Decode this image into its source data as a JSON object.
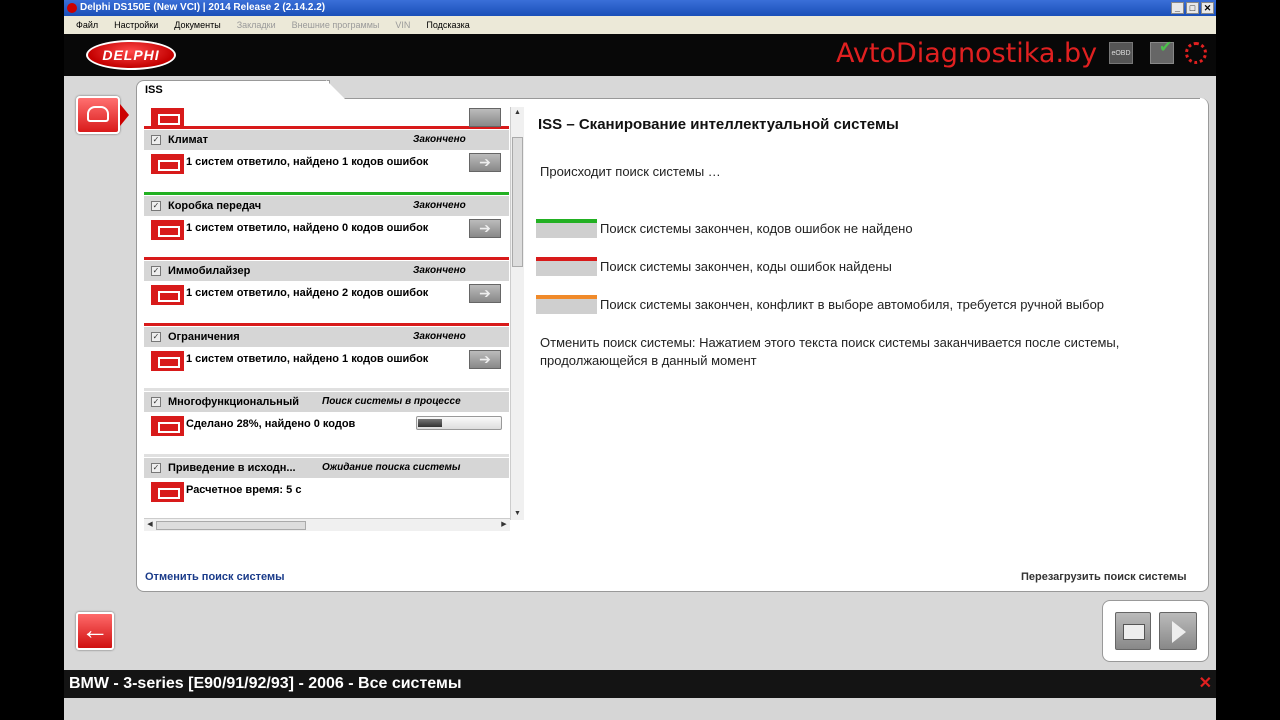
{
  "window": {
    "title": "Delphi DS150E (New VCI) | 2014 Release 2 (2.14.2.2)",
    "buttons": [
      "_",
      "□",
      "✕"
    ]
  },
  "menu": [
    {
      "label": "Файл",
      "enabled": true
    },
    {
      "label": "Настройки",
      "enabled": true
    },
    {
      "label": "Документы",
      "enabled": true
    },
    {
      "label": "Закладки",
      "enabled": false
    },
    {
      "label": "Внешние программы",
      "enabled": false
    },
    {
      "label": "VIN",
      "enabled": false
    },
    {
      "label": "Подсказка",
      "enabled": true
    }
  ],
  "header": {
    "logo_text": "DELPHI",
    "watermark": "AvtoDiagnostika.by",
    "eobd_label": "eOBD"
  },
  "tab_label": "ISS",
  "systems": [
    {
      "name": "Климат",
      "status": "Закончено",
      "desc": "1 систем ответило, найдено 1 кодов ошибок",
      "bar_color": "#d81a1a",
      "icon": "climate-icon",
      "kind": "done"
    },
    {
      "name": "Коробка передач",
      "status": "Закончено",
      "desc": "1 систем ответило, найдено 0 кодов ошибок",
      "bar_color": "#22b022",
      "icon": "gearbox-icon",
      "kind": "done"
    },
    {
      "name": "Иммобилайзер",
      "status": "Закончено",
      "desc": "1 систем ответило, найдено 2 кодов ошибок",
      "bar_color": "#d81a1a",
      "icon": "key-icon",
      "kind": "done"
    },
    {
      "name": "Ограничения",
      "status": "Закончено",
      "desc": "1 систем ответило, найдено 1 кодов ошибок",
      "bar_color": "#d81a1a",
      "icon": "airbag-icon",
      "kind": "done"
    },
    {
      "name": "Многофункциональный",
      "status": "Поиск системы в процессе",
      "desc": "Сделано 28%, найдено 0 кодов",
      "bar_color": "#e0e0e0",
      "icon": "body-icon",
      "kind": "progress",
      "progress": 0.28
    },
    {
      "name": "Приведение в исходн...",
      "status": "Ожидание поиска системы",
      "desc": "Расчетное время: 5 с",
      "bar_color": "#e0e0e0",
      "icon": "wrench-icon",
      "kind": "waiting"
    }
  ],
  "info": {
    "title": "ISS – Сканирование интеллектуальной системы",
    "searching": "Происходит поиск системы …",
    "legend": [
      {
        "color": "#22b022",
        "text": "Поиск системы закончен, кодов ошибок не найдено"
      },
      {
        "color": "#d81a1a",
        "text": "Поиск системы закончен, коды ошибок найдены"
      },
      {
        "color": "#f08a2a",
        "text": "Поиск системы закончен, конфликт в выборе автомобиля, требуется ручной выбор"
      }
    ],
    "cancel_text": "Отменить поиск системы: Нажатием этого текста поиск системы заканчивается после системы, продолжающейся в данный момент"
  },
  "links": {
    "cancel": "Отменить поиск системы",
    "reload": "Перезагрузить поиск системы"
  },
  "status_bar": {
    "vehicle": "BMW - 3-series [E90/91/92/93] - 2006 - Все системы",
    "close": "✕"
  },
  "nav": {
    "back": "←"
  },
  "go_button": "➔"
}
